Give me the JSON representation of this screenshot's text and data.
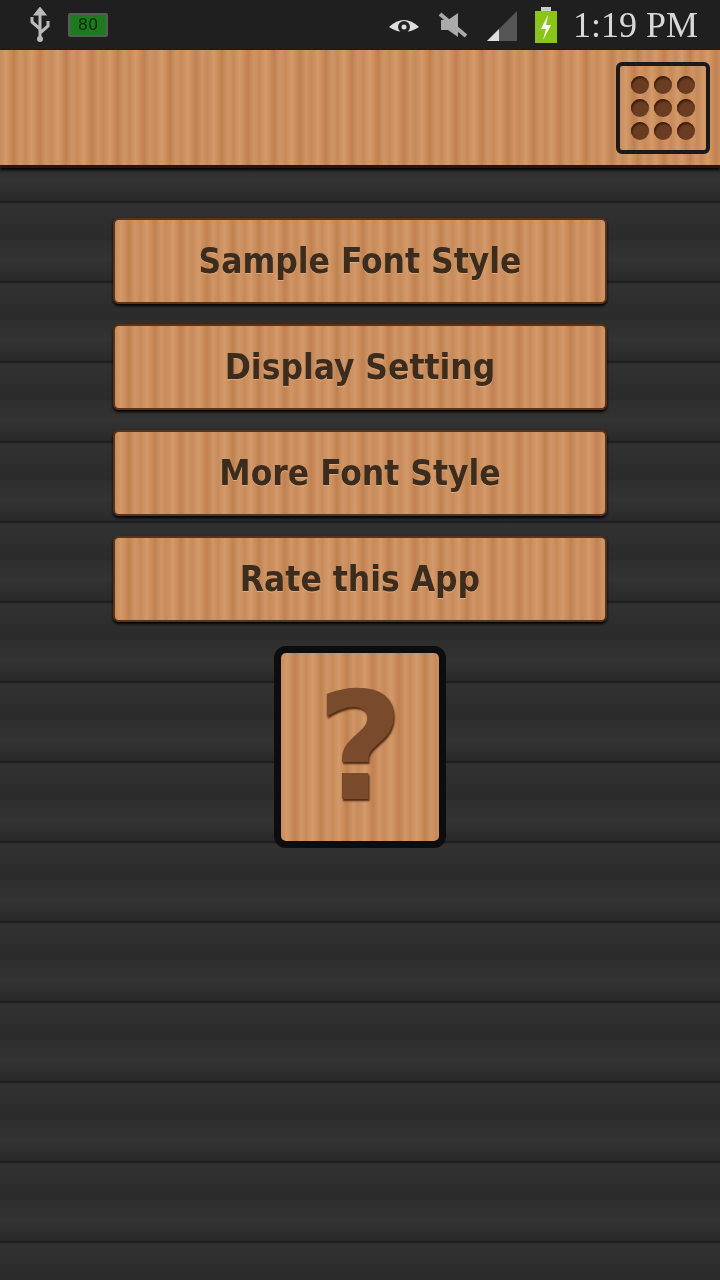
{
  "status_bar": {
    "battery_badge": "80",
    "time": "1:19 PM"
  },
  "menu_buttons": [
    {
      "label": "Sample Font Style"
    },
    {
      "label": "Display Setting"
    },
    {
      "label": "More Font Style"
    },
    {
      "label": "Rate this App"
    }
  ],
  "help_button": {
    "label": "?"
  }
}
